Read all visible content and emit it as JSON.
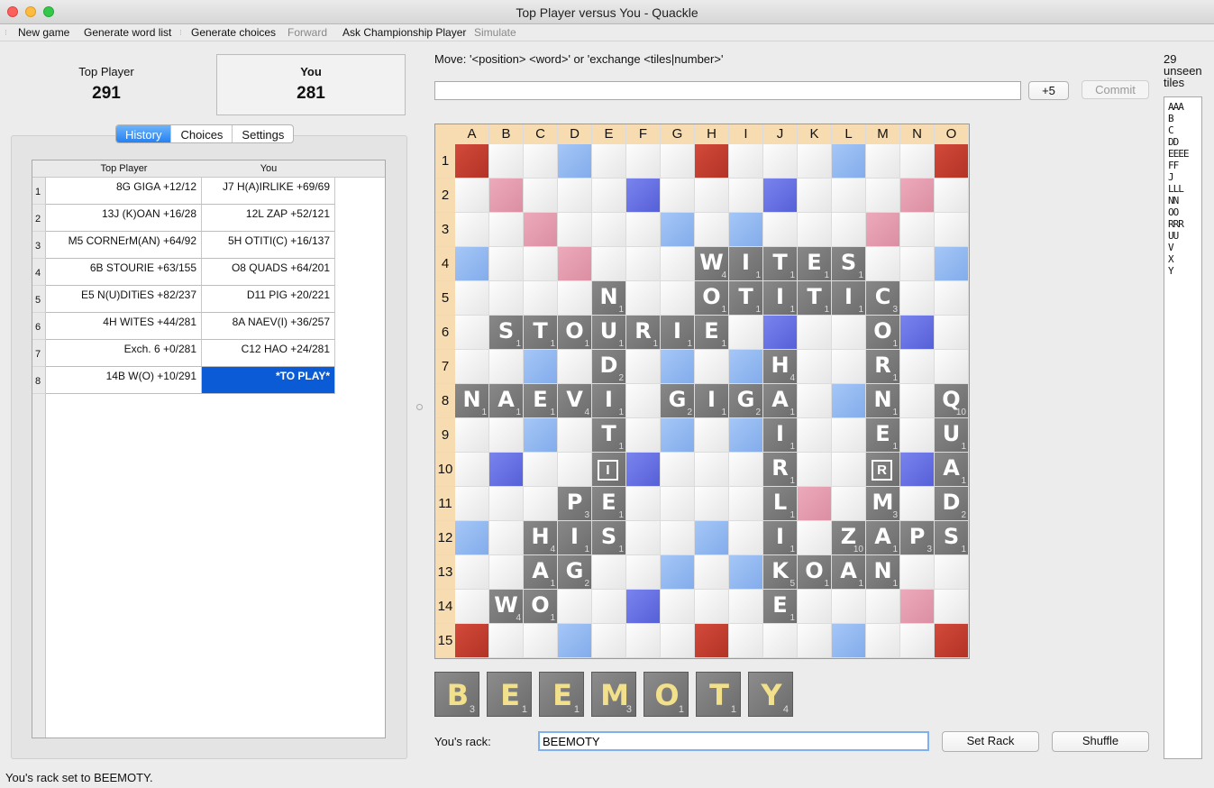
{
  "window": {
    "title": "Top Player versus You - Quackle"
  },
  "toolbar": {
    "new_game": "New game",
    "generate_word_list": "Generate word list",
    "generate_choices": "Generate choices",
    "forward": "Forward",
    "ask_champion": "Ask Championship Player",
    "simulate": "Simulate"
  },
  "scores": {
    "p1": {
      "name": "Top Player",
      "score": "291"
    },
    "p2": {
      "name": "You",
      "score": "281"
    }
  },
  "tabs": {
    "history": "History",
    "choices": "Choices",
    "settings": "Settings"
  },
  "history": {
    "col1": "Top Player",
    "col2": "You",
    "rows": [
      {
        "n": "1",
        "a": "8G GIGA    +12/12",
        "b": "J7 H(A)IRLIKE    +69/69"
      },
      {
        "n": "2",
        "a": "13J (K)OAN    +16/28",
        "b": "12L ZAP    +52/121"
      },
      {
        "n": "3",
        "a": "M5 CORNErM(AN)    +64/92",
        "b": "5H OTITI(C)    +16/137"
      },
      {
        "n": "4",
        "a": "6B STOURIE    +63/155",
        "b": "O8 QUADS    +64/201"
      },
      {
        "n": "5",
        "a": "E5 N(U)DITiES    +82/237",
        "b": "D11 PIG    +20/221"
      },
      {
        "n": "6",
        "a": "4H WITES    +44/281",
        "b": "8A NAEV(I)    +36/257"
      },
      {
        "n": "7",
        "a": "Exch. 6    +0/281",
        "b": "C12 HAO    +24/281"
      },
      {
        "n": "8",
        "a": "14B W(O)    +10/291",
        "b": "*TO PLAY*"
      }
    ]
  },
  "move": {
    "label": "Move: '<position> <word>' or 'exchange <tiles|number>'",
    "input_value": "",
    "plus5": "+5",
    "commit": "Commit"
  },
  "board": {
    "cols": [
      "A",
      "B",
      "C",
      "D",
      "E",
      "F",
      "G",
      "H",
      "I",
      "J",
      "K",
      "L",
      "M",
      "N",
      "O"
    ],
    "rows": [
      "1",
      "2",
      "3",
      "4",
      "5",
      "6",
      "7",
      "8",
      "9",
      "10",
      "11",
      "12",
      "13",
      "14",
      "15"
    ],
    "tiles": [
      {
        "r": 4,
        "c": 8,
        "l": "W",
        "v": "4"
      },
      {
        "r": 4,
        "c": 9,
        "l": "I",
        "v": "1"
      },
      {
        "r": 4,
        "c": 10,
        "l": "T",
        "v": "1"
      },
      {
        "r": 4,
        "c": 11,
        "l": "E",
        "v": "1"
      },
      {
        "r": 4,
        "c": 12,
        "l": "S",
        "v": "1"
      },
      {
        "r": 5,
        "c": 5,
        "l": "N",
        "v": "1"
      },
      {
        "r": 5,
        "c": 8,
        "l": "O",
        "v": "1"
      },
      {
        "r": 5,
        "c": 9,
        "l": "T",
        "v": "1"
      },
      {
        "r": 5,
        "c": 10,
        "l": "I",
        "v": "1"
      },
      {
        "r": 5,
        "c": 11,
        "l": "T",
        "v": "1"
      },
      {
        "r": 5,
        "c": 12,
        "l": "I",
        "v": "1"
      },
      {
        "r": 5,
        "c": 13,
        "l": "C",
        "v": "3"
      },
      {
        "r": 6,
        "c": 2,
        "l": "S",
        "v": "1"
      },
      {
        "r": 6,
        "c": 3,
        "l": "T",
        "v": "1"
      },
      {
        "r": 6,
        "c": 4,
        "l": "O",
        "v": "1"
      },
      {
        "r": 6,
        "c": 5,
        "l": "U",
        "v": "1"
      },
      {
        "r": 6,
        "c": 6,
        "l": "R",
        "v": "1"
      },
      {
        "r": 6,
        "c": 7,
        "l": "I",
        "v": "1"
      },
      {
        "r": 6,
        "c": 8,
        "l": "E",
        "v": "1"
      },
      {
        "r": 6,
        "c": 13,
        "l": "O",
        "v": "1"
      },
      {
        "r": 7,
        "c": 5,
        "l": "D",
        "v": "2"
      },
      {
        "r": 7,
        "c": 10,
        "l": "H",
        "v": "4"
      },
      {
        "r": 7,
        "c": 13,
        "l": "R",
        "v": "1"
      },
      {
        "r": 8,
        "c": 1,
        "l": "N",
        "v": "1"
      },
      {
        "r": 8,
        "c": 2,
        "l": "A",
        "v": "1"
      },
      {
        "r": 8,
        "c": 3,
        "l": "E",
        "v": "1"
      },
      {
        "r": 8,
        "c": 4,
        "l": "V",
        "v": "4"
      },
      {
        "r": 8,
        "c": 5,
        "l": "I",
        "v": "1"
      },
      {
        "r": 8,
        "c": 7,
        "l": "G",
        "v": "2"
      },
      {
        "r": 8,
        "c": 8,
        "l": "I",
        "v": "1"
      },
      {
        "r": 8,
        "c": 9,
        "l": "G",
        "v": "2"
      },
      {
        "r": 8,
        "c": 10,
        "l": "A",
        "v": "1"
      },
      {
        "r": 8,
        "c": 13,
        "l": "N",
        "v": "1"
      },
      {
        "r": 8,
        "c": 15,
        "l": "Q",
        "v": "10"
      },
      {
        "r": 9,
        "c": 5,
        "l": "T",
        "v": "1"
      },
      {
        "r": 9,
        "c": 10,
        "l": "I",
        "v": "1"
      },
      {
        "r": 9,
        "c": 13,
        "l": "E",
        "v": "1"
      },
      {
        "r": 9,
        "c": 15,
        "l": "U",
        "v": "1"
      },
      {
        "r": 10,
        "c": 5,
        "l": "I",
        "v": "",
        "blank": true
      },
      {
        "r": 10,
        "c": 10,
        "l": "R",
        "v": "1"
      },
      {
        "r": 10,
        "c": 13,
        "l": "R",
        "v": "",
        "blank": true
      },
      {
        "r": 10,
        "c": 15,
        "l": "A",
        "v": "1"
      },
      {
        "r": 11,
        "c": 4,
        "l": "P",
        "v": "3"
      },
      {
        "r": 11,
        "c": 5,
        "l": "E",
        "v": "1"
      },
      {
        "r": 11,
        "c": 10,
        "l": "L",
        "v": "1"
      },
      {
        "r": 11,
        "c": 13,
        "l": "M",
        "v": "3"
      },
      {
        "r": 11,
        "c": 15,
        "l": "D",
        "v": "2"
      },
      {
        "r": 12,
        "c": 3,
        "l": "H",
        "v": "4"
      },
      {
        "r": 12,
        "c": 4,
        "l": "I",
        "v": "1"
      },
      {
        "r": 12,
        "c": 5,
        "l": "S",
        "v": "1"
      },
      {
        "r": 12,
        "c": 10,
        "l": "I",
        "v": "1"
      },
      {
        "r": 12,
        "c": 12,
        "l": "Z",
        "v": "10"
      },
      {
        "r": 12,
        "c": 13,
        "l": "A",
        "v": "1"
      },
      {
        "r": 12,
        "c": 14,
        "l": "P",
        "v": "3"
      },
      {
        "r": 12,
        "c": 15,
        "l": "S",
        "v": "1"
      },
      {
        "r": 13,
        "c": 3,
        "l": "A",
        "v": "1"
      },
      {
        "r": 13,
        "c": 4,
        "l": "G",
        "v": "2"
      },
      {
        "r": 13,
        "c": 10,
        "l": "K",
        "v": "5"
      },
      {
        "r": 13,
        "c": 11,
        "l": "O",
        "v": "1"
      },
      {
        "r": 13,
        "c": 12,
        "l": "A",
        "v": "1"
      },
      {
        "r": 13,
        "c": 13,
        "l": "N",
        "v": "1"
      },
      {
        "r": 14,
        "c": 2,
        "l": "W",
        "v": "4"
      },
      {
        "r": 14,
        "c": 3,
        "l": "O",
        "v": "1"
      },
      {
        "r": 14,
        "c": 10,
        "l": "E",
        "v": "1"
      }
    ]
  },
  "rack": {
    "tiles": [
      {
        "l": "B",
        "v": "3"
      },
      {
        "l": "E",
        "v": "1"
      },
      {
        "l": "E",
        "v": "1"
      },
      {
        "l": "M",
        "v": "3"
      },
      {
        "l": "O",
        "v": "1"
      },
      {
        "l": "T",
        "v": "1"
      },
      {
        "l": "Y",
        "v": "4"
      }
    ],
    "label": "You's rack:",
    "input_value": "BEEMOTY",
    "set_rack": "Set Rack",
    "shuffle": "Shuffle"
  },
  "unseen": {
    "count": "29",
    "label1": "unseen",
    "label2": "tiles",
    "items": [
      "AAA",
      "B",
      "C",
      "DD",
      "EEEE",
      "FF",
      "J",
      "LLL",
      "NN",
      "OO",
      "RRR",
      "UU",
      "V",
      "X",
      "Y"
    ]
  },
  "status": "You's rack set to BEEMOTY.",
  "colors": {
    "triple_word": "#c43d2f",
    "double_word": "#e49cae",
    "triple_letter": "#6670e2",
    "double_letter": "#95baf1",
    "tile": "#7a7a7a",
    "selection": "#0b5bd6"
  }
}
